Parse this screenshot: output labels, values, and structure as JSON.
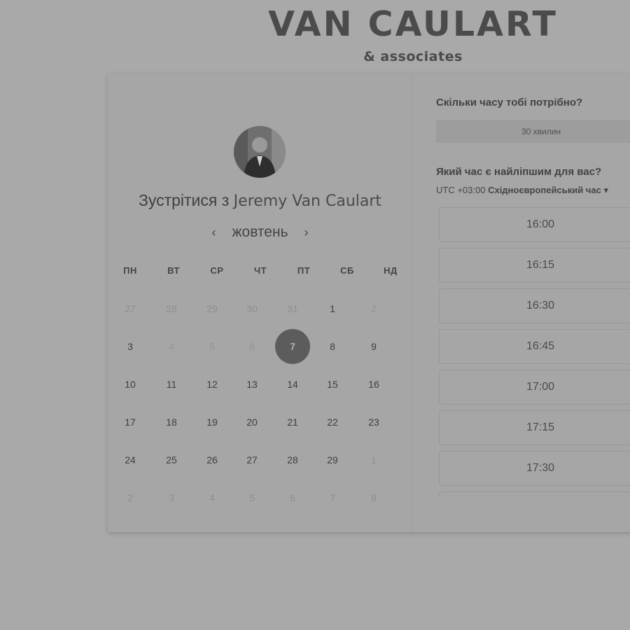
{
  "brand": {
    "name": "VAN CAULART",
    "sub": "& associates"
  },
  "host": {
    "prefix": "Зустрітися з",
    "name": "Jeremy Van Caulart",
    "avatar_icon": "avatar-photo"
  },
  "calendar": {
    "month": "жовтень",
    "prev_icon": "‹",
    "next_icon": "›",
    "weekdays": [
      "ПН",
      "ВТ",
      "СР",
      "ЧТ",
      "ПТ",
      "СБ",
      "НД"
    ],
    "weeks": [
      [
        {
          "d": "27",
          "s": "muted"
        },
        {
          "d": "28",
          "s": "muted"
        },
        {
          "d": "29",
          "s": "muted"
        },
        {
          "d": "30",
          "s": "muted"
        },
        {
          "d": "31",
          "s": "muted"
        },
        {
          "d": "1",
          "s": "normal"
        },
        {
          "d": "2",
          "s": "disabled"
        }
      ],
      [
        {
          "d": "3",
          "s": "normal"
        },
        {
          "d": "4",
          "s": "disabled"
        },
        {
          "d": "5",
          "s": "disabled"
        },
        {
          "d": "6",
          "s": "disabled"
        },
        {
          "d": "7",
          "s": "selected"
        },
        {
          "d": "8",
          "s": "normal"
        },
        {
          "d": "9",
          "s": "normal"
        }
      ],
      [
        {
          "d": "10",
          "s": "normal"
        },
        {
          "d": "11",
          "s": "normal"
        },
        {
          "d": "12",
          "s": "normal"
        },
        {
          "d": "13",
          "s": "normal"
        },
        {
          "d": "14",
          "s": "normal"
        },
        {
          "d": "15",
          "s": "normal"
        },
        {
          "d": "16",
          "s": "normal"
        }
      ],
      [
        {
          "d": "17",
          "s": "normal"
        },
        {
          "d": "18",
          "s": "normal"
        },
        {
          "d": "19",
          "s": "normal"
        },
        {
          "d": "20",
          "s": "normal"
        },
        {
          "d": "21",
          "s": "normal"
        },
        {
          "d": "22",
          "s": "normal"
        },
        {
          "d": "23",
          "s": "normal"
        }
      ],
      [
        {
          "d": "24",
          "s": "normal"
        },
        {
          "d": "25",
          "s": "normal"
        },
        {
          "d": "26",
          "s": "normal"
        },
        {
          "d": "27",
          "s": "normal"
        },
        {
          "d": "28",
          "s": "normal"
        },
        {
          "d": "29",
          "s": "normal"
        },
        {
          "d": "1",
          "s": "muted"
        }
      ],
      [
        {
          "d": "2",
          "s": "muted"
        },
        {
          "d": "3",
          "s": "muted"
        },
        {
          "d": "4",
          "s": "muted"
        },
        {
          "d": "5",
          "s": "muted"
        },
        {
          "d": "6",
          "s": "muted"
        },
        {
          "d": "7",
          "s": "muted"
        },
        {
          "d": "8",
          "s": "muted"
        }
      ]
    ]
  },
  "booking": {
    "duration_question": "Скільки часу тобі потрібно?",
    "duration_value": "30 хвилин",
    "time_question": "Який час є найліпшим для вас?",
    "timezone_offset": "UTC +03:00",
    "timezone_name": "Східноєвропейський час",
    "timezone_caret": "▾",
    "slots": [
      "16:00",
      "16:15",
      "16:30",
      "16:45",
      "17:00",
      "17:15",
      "17:30"
    ]
  }
}
